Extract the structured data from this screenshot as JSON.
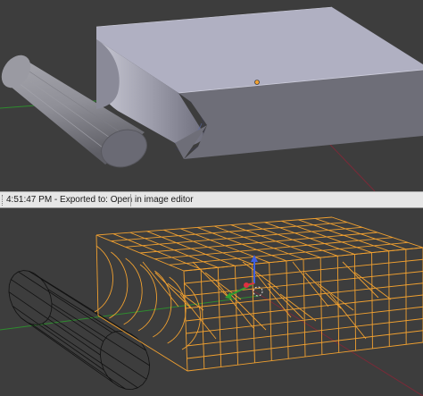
{
  "status_bar": {
    "message": "4:51:47 PM - Exported to: Open in image editor"
  },
  "viewports": {
    "top": {
      "shading": "solid",
      "icon": "solid-shaded-view"
    },
    "bottom": {
      "shading": "wireframe",
      "icon": "wireframe-view"
    }
  },
  "colors": {
    "viewport_bg": "#3d3d3d",
    "selection_orange": "#f0a030",
    "axis_x_red": "#b03040",
    "axis_y_green": "#30a030",
    "gizmo_blue": "#4060e0"
  }
}
